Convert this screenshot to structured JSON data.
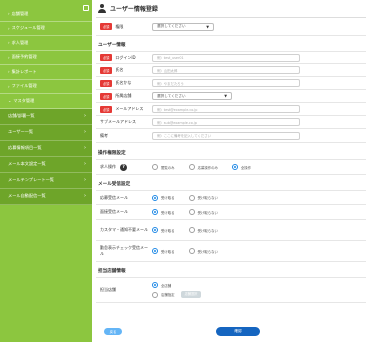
{
  "sidebar": {
    "items": [
      {
        "label": "店舗管理"
      },
      {
        "label": "スケジュール管理"
      },
      {
        "label": "求人管理"
      },
      {
        "label": "面接予約管理"
      },
      {
        "label": "集計レポート"
      },
      {
        "label": "ファイル管理"
      },
      {
        "label": "マスタ管理"
      }
    ],
    "sub_items": [
      {
        "label": "店舗/部署一覧"
      },
      {
        "label": "ユーザー一覧"
      },
      {
        "label": "応募情報項目一覧"
      },
      {
        "label": "メール本文設定一覧"
      },
      {
        "label": "メールテンプレート一覧"
      },
      {
        "label": "メール自動配信一覧"
      }
    ]
  },
  "header": {
    "title": "ユーザー情報登録"
  },
  "form": {
    "required_badge": "必須",
    "store": {
      "label": "権限",
      "select_value": "選択してください"
    },
    "user_section_title": "ユーザー情報",
    "fields": [
      {
        "label": "ログインID",
        "placeholder": "例）test_user01"
      },
      {
        "label": "氏名",
        "placeholder": "例）山田太郎"
      },
      {
        "label": "氏名かな",
        "placeholder": "例）やまだたろう"
      },
      {
        "label": "所属店舗",
        "select_value": "選択してください"
      },
      {
        "label": "メールアドレス",
        "placeholder": "例）test@example.co.jp"
      }
    ],
    "sub_email": {
      "label": "サブメールアドレス",
      "placeholder": "例）sub@example.co.jp"
    },
    "memo": {
      "label": "備考",
      "placeholder": "例）ここに備考を記入してください"
    },
    "operation_section_title": "操作権限設定",
    "operation": {
      "label": "求人操作",
      "options": [
        "閲覧のみ",
        "応募操作のみ",
        "全操作"
      ],
      "selected_index": 2
    },
    "mail_section_title": "メール受信設定",
    "mail_settings": [
      {
        "label": "応募受信メール",
        "options": [
          "受け取る",
          "受け取らない"
        ],
        "selected_index": 0
      },
      {
        "label": "面接受信メール",
        "options": [
          "受け取る",
          "受け取らない"
        ],
        "selected_index": 0
      },
      {
        "label": "カスタマ・通知不要メール",
        "options": [
          "受け取る",
          "受け取らない"
        ],
        "selected_index": 0
      },
      {
        "label": "勤怠表示チェック受信メール",
        "options": [
          "受け取る",
          "受け取らない"
        ],
        "selected_index": 0
      }
    ],
    "store_info_section_title": "担当店舗情報",
    "store_info": {
      "label": "担当店舗",
      "options": [
        "全店舗",
        "店舗指定"
      ],
      "selected_index": 0,
      "select_button": "店舗選択"
    }
  },
  "footer": {
    "back_label": "戻る",
    "confirm_label": "確認"
  }
}
